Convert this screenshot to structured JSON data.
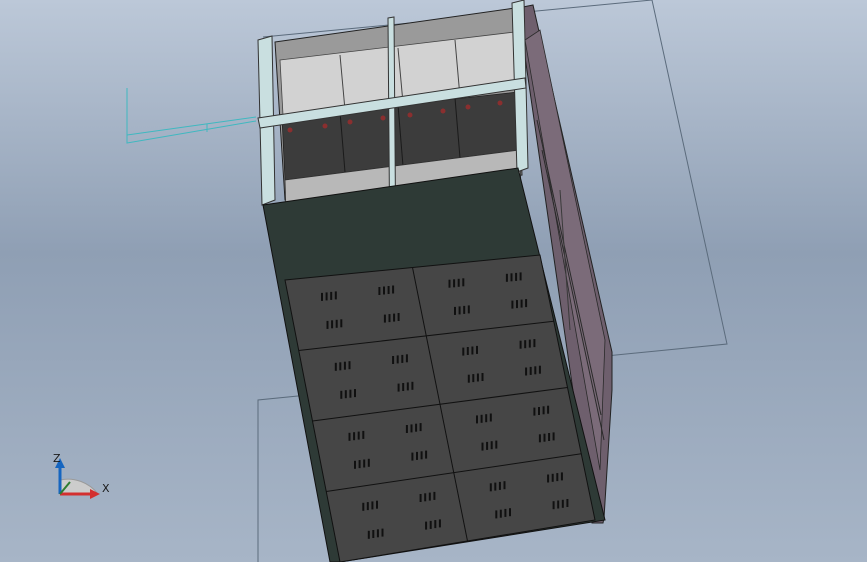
{
  "viewport": {
    "background_top": "#bcc8d8",
    "background_bottom": "#a7b5c7"
  },
  "model": {
    "rack_frame_color": "#c9dfe0",
    "front_panel_color": "#454545",
    "side_panel_color": "#6e5f6d",
    "vent_slot_color": "#101010",
    "battery_color": "#d0d0d0",
    "front_panels": 8,
    "vent_rows_per_panel": 2,
    "battery_columns": 4
  },
  "triad": {
    "z_label": "Z",
    "x_label": "X",
    "z_color": "#1565c0",
    "x_color": "#d32f2f",
    "y_color": "#2e7d32"
  }
}
